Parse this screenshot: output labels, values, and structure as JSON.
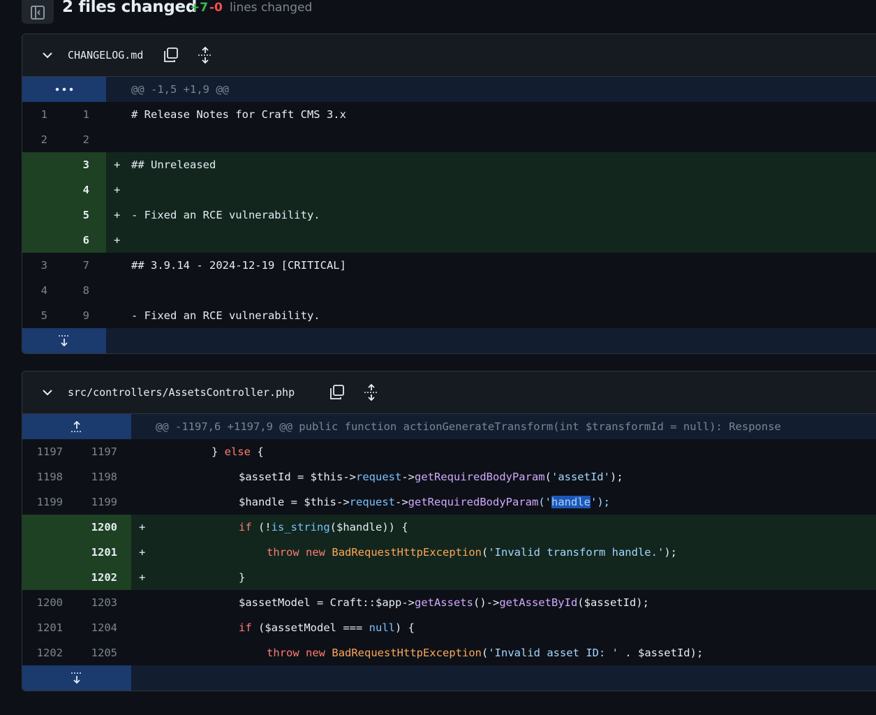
{
  "summary": {
    "files_changed": "2 files changed",
    "additions": "+7",
    "deletions": "-0",
    "label": "lines changed"
  },
  "files": [
    {
      "name": "CHANGELOG.md",
      "hunk": "@@ -1,5 +1,9 @@",
      "lines": [
        {
          "old": "1",
          "new": "1",
          "sign": "",
          "text": "# Release Notes for Craft CMS 3.x",
          "type": "ctx"
        },
        {
          "old": "2",
          "new": "2",
          "sign": "",
          "text": "",
          "type": "ctx"
        },
        {
          "old": "",
          "new": "3",
          "sign": "+",
          "text": "## Unreleased",
          "type": "add"
        },
        {
          "old": "",
          "new": "4",
          "sign": "+",
          "text": "",
          "type": "add"
        },
        {
          "old": "",
          "new": "5",
          "sign": "+",
          "text": "- Fixed an RCE vulnerability.",
          "type": "add"
        },
        {
          "old": "",
          "new": "6",
          "sign": "+",
          "text": "",
          "type": "add"
        },
        {
          "old": "3",
          "new": "7",
          "sign": "",
          "text": "## 3.9.14 - 2024-12-19 [CRITICAL]",
          "type": "ctx"
        },
        {
          "old": "4",
          "new": "8",
          "sign": "",
          "text": "",
          "type": "ctx"
        },
        {
          "old": "5",
          "new": "9",
          "sign": "",
          "text": "- Fixed an RCE vulnerability.",
          "type": "ctx"
        }
      ]
    },
    {
      "name": "src/controllers/AssetsController.php",
      "hunk": "@@ -1197,6 +1197,9 @@ public function actionGenerateTransform(int $transformId = null): Response",
      "lines": [
        {
          "old": "1197",
          "new": "1197",
          "sign": "",
          "type": "ctx"
        },
        {
          "old": "1198",
          "new": "1198",
          "sign": "",
          "type": "ctx"
        },
        {
          "old": "1199",
          "new": "1199",
          "sign": "",
          "type": "ctx"
        },
        {
          "old": "",
          "new": "1200",
          "sign": "+",
          "type": "add"
        },
        {
          "old": "",
          "new": "1201",
          "sign": "+",
          "type": "add"
        },
        {
          "old": "",
          "new": "1202",
          "sign": "+",
          "type": "add"
        },
        {
          "old": "1200",
          "new": "1203",
          "sign": "",
          "type": "ctx"
        },
        {
          "old": "1201",
          "new": "1204",
          "sign": "",
          "type": "ctx"
        },
        {
          "old": "1202",
          "new": "1205",
          "sign": "",
          "type": "ctx"
        }
      ],
      "code_tokens": {
        "l1": [
          "} ",
          "else",
          " {"
        ],
        "l2": [
          "$assetId",
          " = ",
          "$this",
          "->",
          "request",
          "->",
          "getRequiredBodyParam",
          "(",
          "'assetId'",
          ");"
        ],
        "l3": [
          "$handle",
          " = ",
          "$this",
          "->",
          "request",
          "->",
          "getRequiredBodyParam",
          "('",
          "handle",
          "');"
        ],
        "l4": [
          "if",
          " (!",
          "is_string",
          "(",
          "$handle",
          ")) {"
        ],
        "l5": [
          "throw",
          " ",
          "new",
          " ",
          "BadRequestHttpException",
          "(",
          "'Invalid transform handle.'",
          ");"
        ],
        "l6": [
          "}"
        ],
        "l7": [
          "$assetModel",
          " = Craft::",
          "$app",
          "->",
          "getAssets",
          "()->",
          "getAssetById",
          "(",
          "$assetId",
          ");"
        ],
        "l8": [
          "if",
          " (",
          "$assetModel",
          " === ",
          "null",
          ") {"
        ],
        "l9": [
          "throw",
          " ",
          "new",
          " ",
          "BadRequestHttpException",
          "(",
          "'Invalid asset ID: '",
          " . ",
          "$assetId",
          ");"
        ]
      }
    }
  ],
  "colors": {
    "add_bg": "#12261e",
    "add_gutter": "#1e4023",
    "hunk_bg": "#121d2f",
    "hunk_gutter": "#1b3a6e",
    "keyword": "#ff7b72",
    "function": "#d2a8ff",
    "string": "#a5d6ff"
  },
  "icons": {
    "sidebar_toggle": "sidebar-toggle-icon",
    "collapse": "chevron-down-icon",
    "copy": "copy-icon",
    "expand_all": "unfold-icon",
    "expand_up": "expand-up-icon",
    "expand_down": "expand-down-icon",
    "ellipsis": "ellipsis-icon"
  }
}
